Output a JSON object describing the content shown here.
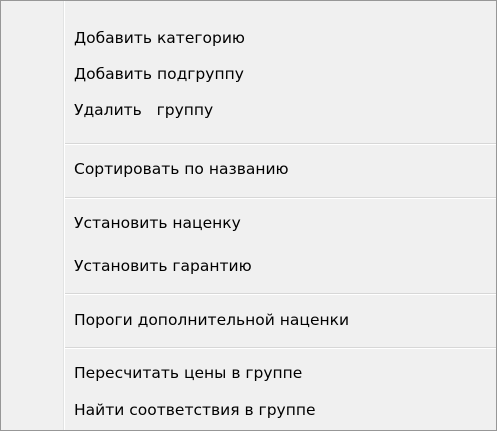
{
  "context_menu": {
    "items": [
      {
        "label": "Добавить категорию"
      },
      {
        "label": "Добавить подгруппу"
      },
      {
        "label": "Удалить   группу"
      },
      {
        "label": "Сортировать по названию"
      },
      {
        "label": "Установить наценку"
      },
      {
        "label": "Установить гарантию"
      },
      {
        "label": "Пороги дополнительной наценки"
      },
      {
        "label": "Пересчитать цены в группе"
      },
      {
        "label": "Найти соответствия в группе"
      }
    ]
  },
  "colors": {
    "background": "#f0f0f0",
    "border": "#979797",
    "separator": "#d7d7d7",
    "text": "#000000"
  }
}
